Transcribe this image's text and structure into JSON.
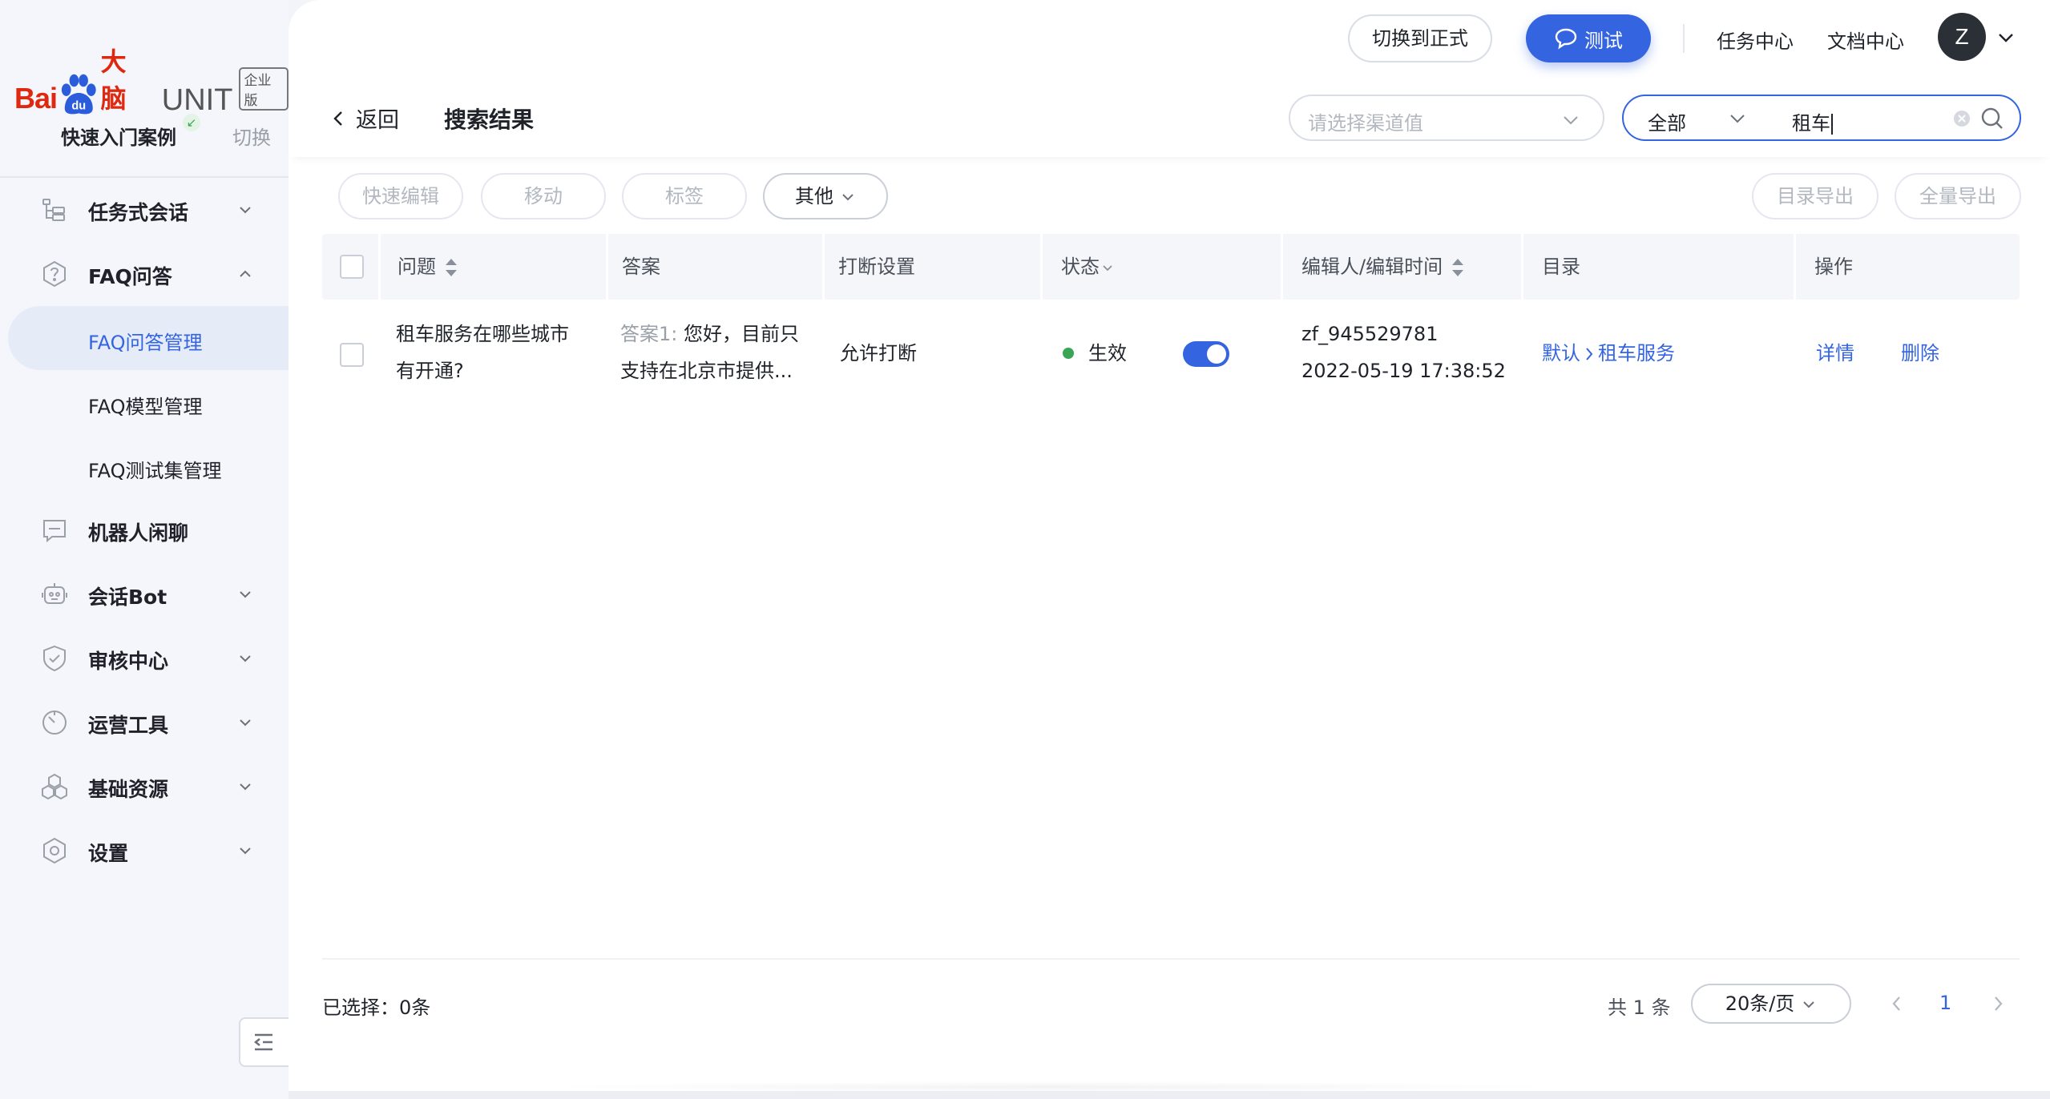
{
  "brand": {
    "bai": "Bai",
    "du": "du",
    "danao": "大脑",
    "unit": "UNIT",
    "edition": "企业版"
  },
  "case": {
    "name": "快速入门案例",
    "pin_icon": "pin-icon",
    "switch_label": "切换"
  },
  "sidebar": {
    "items": [
      {
        "label": "任务式会话",
        "icon": "task-tree-icon",
        "expandable": true
      },
      {
        "label": "FAQ问答",
        "icon": "question-hexagon-icon",
        "expandable": true,
        "expanded": true
      },
      {
        "label": "机器人闲聊",
        "icon": "chat-bubble-icon",
        "expandable": false
      },
      {
        "label": "会话Bot",
        "icon": "robot-icon",
        "expandable": true
      },
      {
        "label": "审核中心",
        "icon": "shield-check-icon",
        "expandable": true
      },
      {
        "label": "运营工具",
        "icon": "gauge-icon",
        "expandable": true
      },
      {
        "label": "基础资源",
        "icon": "hexagons-icon",
        "expandable": true
      },
      {
        "label": "设置",
        "icon": "settings-hexagon-icon",
        "expandable": true
      }
    ],
    "faq_sub": [
      {
        "label": "FAQ问答管理",
        "active": true
      },
      {
        "label": "FAQ模型管理",
        "active": false
      },
      {
        "label": "FAQ测试集管理",
        "active": false
      }
    ]
  },
  "header": {
    "switch_env": "切换到正式",
    "test": "测试",
    "task_center": "任务中心",
    "doc_center": "文档中心",
    "avatar_initial": "Z"
  },
  "search": {
    "back": "返回",
    "title": "搜索结果",
    "channel_placeholder": "请选择渠道值",
    "scope": "全部",
    "query": "租车"
  },
  "toolbar": {
    "quick_edit": "快速编辑",
    "move": "移动",
    "tag": "标签",
    "other": "其他",
    "export_dir": "目录导出",
    "export_all": "全量导出"
  },
  "table": {
    "headers": {
      "question": "问题",
      "answer": "答案",
      "interrupt": "打断设置",
      "status": "状态",
      "editor": "编辑人/编辑时间",
      "directory": "目录",
      "action": "操作"
    },
    "rows": [
      {
        "question_line1": "租车服务在哪些城市",
        "question_line2": "有开通?",
        "answer_label": "答案1:",
        "answer_line1": "您好，目前只",
        "answer_line2": "支持在北京市提供...",
        "interrupt": "允许打断",
        "status": "生效",
        "enabled": true,
        "editor": "zf_945529781",
        "edit_time": "2022-05-19 17:38:52",
        "dir_root": "默认",
        "dir_leaf": "租车服务",
        "detail": "详情",
        "delete": "删除"
      }
    ]
  },
  "footer": {
    "selected": "已选择：0条",
    "total": "共 1 条",
    "page_size": "20条/页",
    "current_page": "1"
  },
  "colors": {
    "primary": "#3464e0",
    "success": "#3aa655",
    "brand_red": "#de2910"
  }
}
